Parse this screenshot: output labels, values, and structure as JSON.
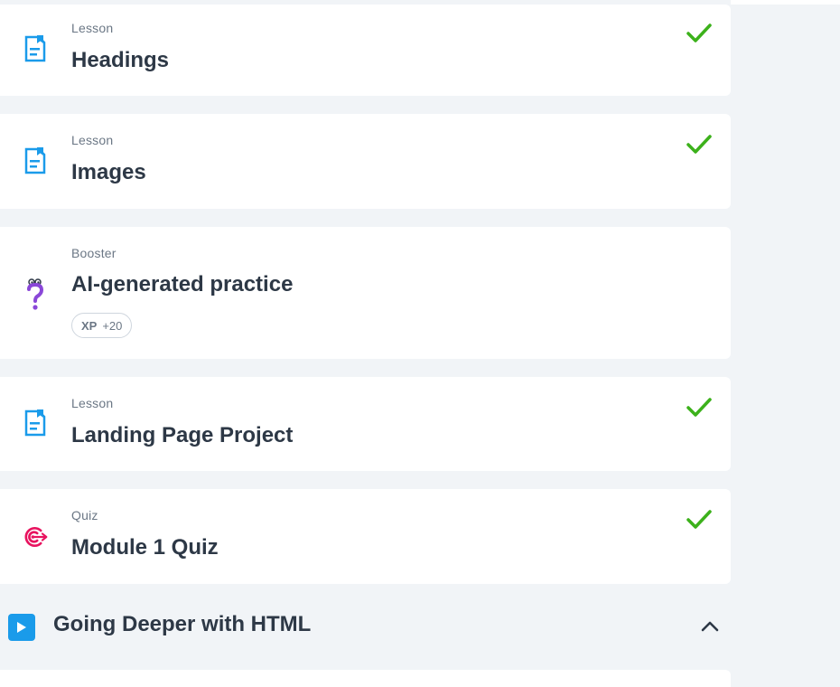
{
  "items": [
    {
      "type": "Lesson",
      "title": "Headings",
      "icon": "lesson-document-icon",
      "completed": true
    },
    {
      "type": "Lesson",
      "title": "Images",
      "icon": "lesson-document-icon",
      "completed": true
    },
    {
      "type": "Booster",
      "title": "AI-generated practice",
      "icon": "question-character-icon",
      "completed": false,
      "xp": {
        "label": "XP",
        "value": "+20"
      }
    },
    {
      "type": "Lesson",
      "title": "Landing Page Project",
      "icon": "lesson-document-icon",
      "completed": true
    },
    {
      "type": "Quiz",
      "title": "Module 1 Quiz",
      "icon": "target-icon",
      "completed": true
    }
  ],
  "section": {
    "title": "Going Deeper with HTML",
    "icon": "play-icon",
    "expanded": true
  },
  "colors": {
    "accent": "#1a9bea",
    "check": "#3cb11b",
    "quiz": "#e8135f",
    "booster": "#8a47d8",
    "background": "#f1f4f7"
  }
}
